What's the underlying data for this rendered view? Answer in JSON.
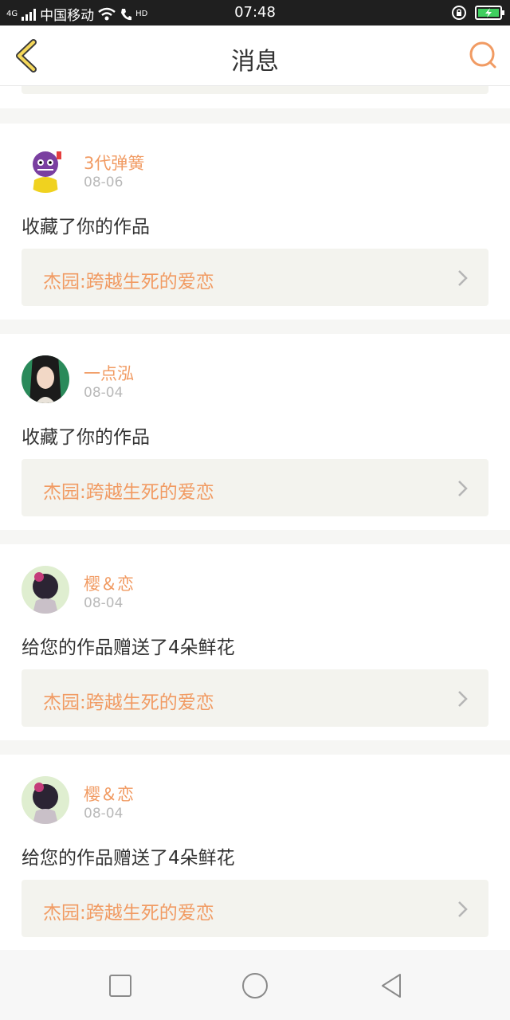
{
  "status_bar": {
    "network_type": "4G",
    "carrier": "中国移动",
    "call_badge": "HD",
    "time": "07:48"
  },
  "header": {
    "title": "消息",
    "back_icon": "chevron-left-icon",
    "search_icon": "search-icon"
  },
  "colors": {
    "accent": "#f19b63",
    "work_bg": "#f3f3ee",
    "text": "#333333",
    "muted": "#b9b9b9"
  },
  "messages": [
    {
      "user": "3代弹簧",
      "date": "08-06",
      "action": "收藏了你的作品",
      "work": "杰园:跨越生死的爱恋"
    },
    {
      "user": "一点泓",
      "date": "08-04",
      "action": "收藏了你的作品",
      "work": "杰园:跨越生死的爱恋"
    },
    {
      "user": "樱＆恋",
      "date": "08-04",
      "action": "给您的作品赠送了4朵鲜花",
      "work": "杰园:跨越生死的爱恋"
    },
    {
      "user": "樱＆恋",
      "date": "08-04",
      "action": "给您的作品赠送了4朵鲜花",
      "work": "杰园:跨越生死的爱恋"
    }
  ]
}
